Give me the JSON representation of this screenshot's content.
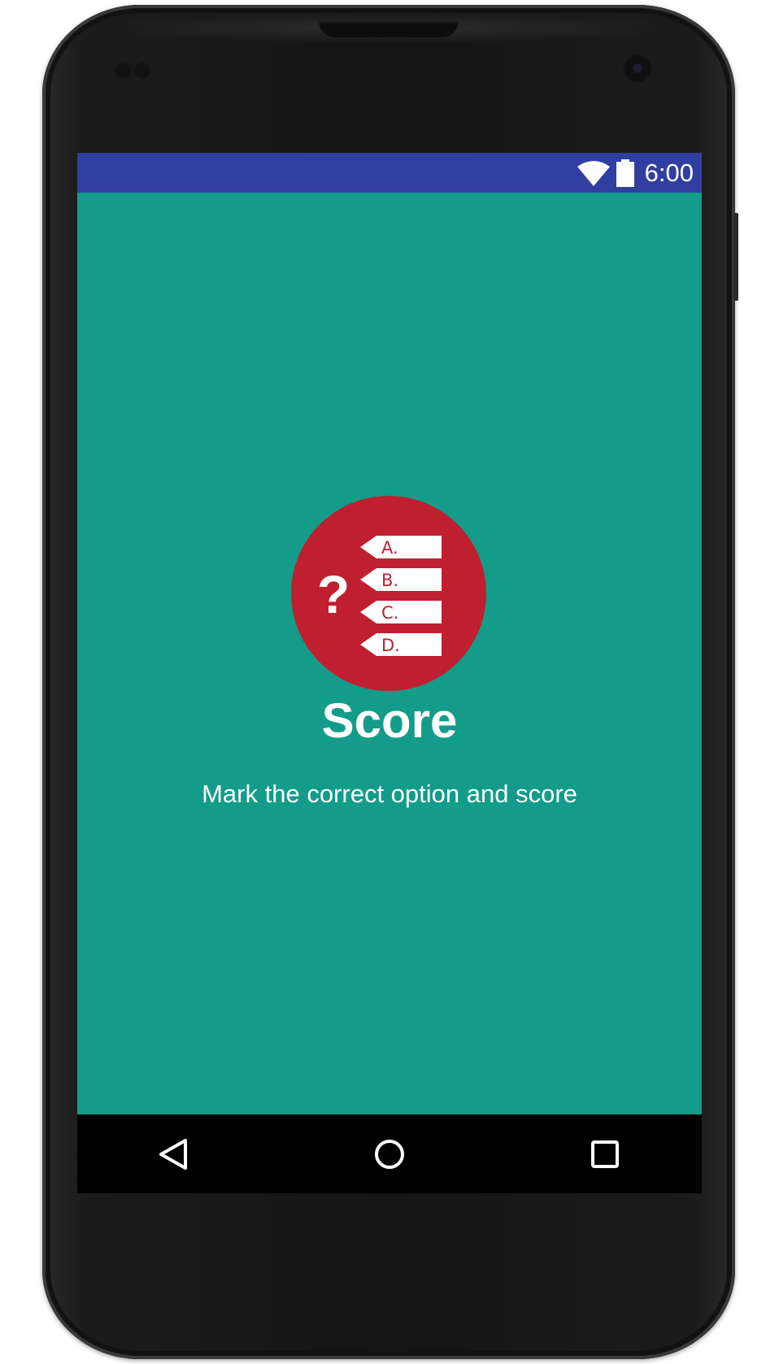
{
  "status_bar": {
    "time": "6:00",
    "background_color": "#303f9f",
    "icons": [
      "wifi-icon",
      "battery-icon"
    ]
  },
  "splash": {
    "background_color": "#129c89",
    "logo": {
      "icon": "quiz-options-icon",
      "circle_color": "#c01f2f",
      "question_mark": "?",
      "options": [
        "A.",
        "B.",
        "C.",
        "D."
      ]
    },
    "title": "Score",
    "subtitle": "Mark the correct option and score"
  },
  "nav_bar": {
    "buttons": [
      {
        "name": "back",
        "icon": "back-triangle-icon"
      },
      {
        "name": "home",
        "icon": "home-circle-icon"
      },
      {
        "name": "recents",
        "icon": "recents-square-icon"
      }
    ]
  }
}
